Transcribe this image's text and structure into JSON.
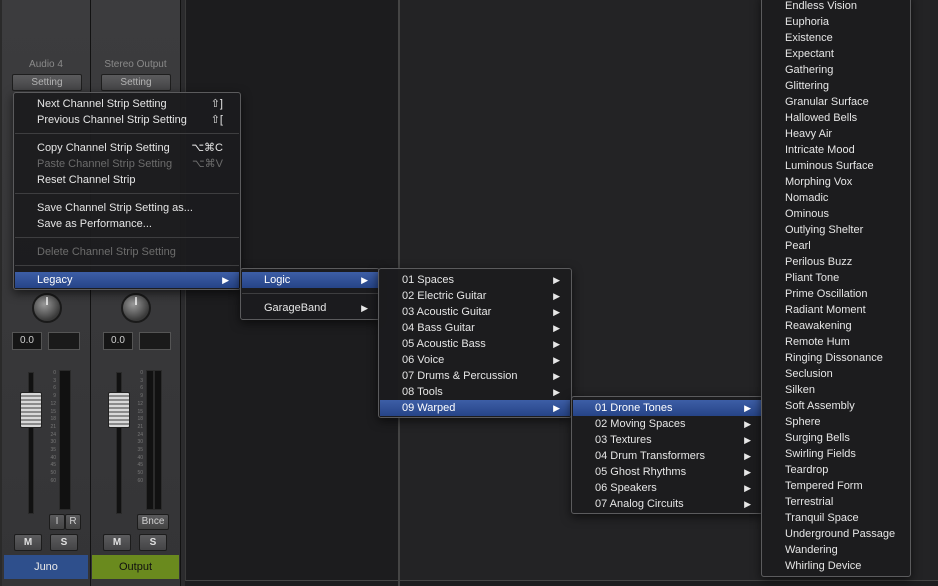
{
  "mixer": {
    "strips": [
      {
        "name": "Audio 4",
        "setting_label": "Setting",
        "pan_value": "0.0",
        "btn_i": "I",
        "btn_r": "R",
        "mute": "M",
        "solo": "S",
        "label": "Juno",
        "label_color": "#2e4f8c"
      },
      {
        "name": "Stereo Output",
        "setting_label": "Setting",
        "pan_value": "0.0",
        "btn_bnce": "Bnce",
        "mute": "M",
        "solo": "S",
        "label": "Output",
        "label_color": "#6a8a1e"
      }
    ],
    "meter_scale": [
      "0",
      "3",
      "6",
      "9",
      "12",
      "15",
      "18",
      "21",
      "24",
      "30",
      "35",
      "40",
      "45",
      "50",
      "60"
    ]
  },
  "menu_main": {
    "items": [
      {
        "label": "Next Channel Strip Setting",
        "shortcut": "⇧]",
        "disabled": false
      },
      {
        "label": "Previous Channel Strip Setting",
        "shortcut": "⇧[",
        "disabled": false
      },
      {
        "label": "Copy Channel Strip Setting",
        "shortcut": "⌥⌘C",
        "disabled": false
      },
      {
        "label": "Paste Channel Strip Setting",
        "shortcut": "⌥⌘V",
        "disabled": true
      },
      {
        "label": "Reset Channel Strip",
        "shortcut": "",
        "disabled": false
      },
      {
        "label": "Save Channel Strip Setting as...",
        "shortcut": "",
        "disabled": false
      },
      {
        "label": "Save as Performance...",
        "shortcut": "",
        "disabled": false
      },
      {
        "label": "Delete Channel Strip Setting",
        "shortcut": "",
        "disabled": true
      },
      {
        "label": "Legacy",
        "shortcut": "",
        "disabled": false
      }
    ]
  },
  "menu_legacy": {
    "items": [
      {
        "label": "Logic"
      },
      {
        "label": "GarageBand"
      }
    ]
  },
  "menu_logic": {
    "items": [
      {
        "label": "01 Spaces"
      },
      {
        "label": "02 Electric Guitar"
      },
      {
        "label": "03 Acoustic Guitar"
      },
      {
        "label": "04 Bass Guitar"
      },
      {
        "label": "05 Acoustic Bass"
      },
      {
        "label": "06 Voice"
      },
      {
        "label": "07 Drums & Percussion"
      },
      {
        "label": "08 Tools"
      },
      {
        "label": "09 Warped"
      }
    ]
  },
  "menu_warped": {
    "items": [
      {
        "label": "01 Drone Tones"
      },
      {
        "label": "02 Moving Spaces"
      },
      {
        "label": "03 Textures"
      },
      {
        "label": "04 Drum Transformers"
      },
      {
        "label": "05 Ghost Rhythms"
      },
      {
        "label": "06 Speakers"
      },
      {
        "label": "07 Analog Circuits"
      }
    ]
  },
  "menu_drone": {
    "items": [
      "Endless Vision",
      "Euphoria",
      "Existence",
      "Expectant",
      "Gathering",
      "Glittering",
      "Granular Surface",
      "Hallowed Bells",
      "Heavy Air",
      "Intricate Mood",
      "Luminous Surface",
      "Morphing Vox",
      "Nomadic",
      "Ominous",
      "Outlying Shelter",
      "Pearl",
      "Perilous Buzz",
      "Pliant Tone",
      "Prime Oscillation",
      "Radiant Moment",
      "Reawakening",
      "Remote Hum",
      "Ringing Dissonance",
      "Seclusion",
      "Silken",
      "Soft Assembly",
      "Sphere",
      "Surging Bells",
      "Swirling Fields",
      "Teardrop",
      "Tempered Form",
      "Terrestrial",
      "Tranquil Space",
      "Underground Passage",
      "Wandering",
      "Whirling Device"
    ]
  },
  "submenu_arrow": "▶"
}
